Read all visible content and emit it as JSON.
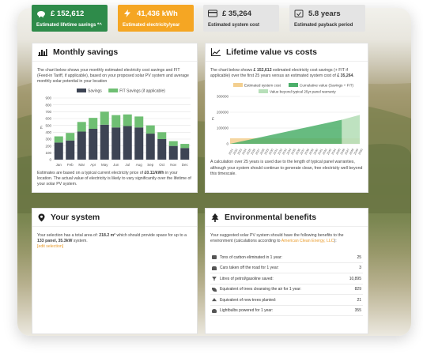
{
  "stats": [
    {
      "value": "£ 152,612",
      "label": "Estimated lifetime savings *^",
      "icon": "piggy-bank-icon"
    },
    {
      "value": "41,436 kWh",
      "label": "Estimated electricity/year",
      "icon": "lightning-icon"
    },
    {
      "value": "£ 35,264",
      "label": "Estimated system cost",
      "icon": "credit-card-icon"
    },
    {
      "value": "5.8 years",
      "label": "Estimated payback period",
      "icon": "calendar-check-icon"
    }
  ],
  "monthly": {
    "title": "Monthly savings",
    "intro": "The chart below shows your monthly estimated electricity cost savings and FIT (Feed-in Tariff, if applicable), based on your proposed solar PV system and average monthly solar potential in your location",
    "footnote_a": "Estimates are based on a typical current electricity price of ",
    "price": "£0.11/kWh",
    "footnote_b": " in your location. The actual value of electricity is likely to vary significantly over the lifetime of your solar PV system."
  },
  "lifetime": {
    "title": "Lifetime value vs costs",
    "intro_a": "The chart below shows ",
    "savings": "£ 152,612",
    "intro_b": " estimated electricity cost savings (+ FIT if applicable) over the first 25 years versus an estimated system cost of ",
    "cost": "£ 35,264",
    "intro_c": ".",
    "footnote": "A calculation over 25 years is used due to the length of typical panel warranties, although your system should continue to generate clean, free electricity well beyond this timescale."
  },
  "system": {
    "title": "Your system",
    "text_a": "Your selection has a total area of: ",
    "area": "218.2 m²",
    "text_b": " which should provide space for up to a ",
    "panels": "133 panel, 35.3kW",
    "text_c": " system.",
    "edit_label": "[edit selection]"
  },
  "benefits": {
    "title": "Environmental benefits",
    "intro_a": "Your suggested solar PV system should have the following benefits to the environment (calculations according to ",
    "source": "American Clean Energy, LLC",
    "intro_b": "):",
    "rows": [
      {
        "label": "Tons of carbon eliminated in 1 year:",
        "value": "25"
      },
      {
        "label": "Cars taken off the road for 1 year:",
        "value": "3"
      },
      {
        "label": "Litres of petrol/gasoline saved:",
        "value": "10,895"
      },
      {
        "label": "Equivalent of trees cleansing the air for 1 year:",
        "value": "829"
      },
      {
        "label": "Equivalent of new trees planted:",
        "value": "21"
      },
      {
        "label": "Lightbulbs powered for 1 year:",
        "value": "355"
      }
    ]
  },
  "chart_data": [
    {
      "type": "bar",
      "categories": [
        "Jan",
        "Feb",
        "Mar",
        "Apr",
        "May",
        "Jun",
        "Jul",
        "Aug",
        "Sep",
        "Oct",
        "Nov",
        "Dec"
      ],
      "series": [
        {
          "name": "Savings",
          "values": [
            250,
            280,
            410,
            450,
            510,
            470,
            490,
            470,
            380,
            300,
            200,
            170
          ],
          "color": "#3d4454"
        },
        {
          "name": "FIT Savings (if applicable)",
          "values": [
            90,
            110,
            140,
            160,
            190,
            180,
            170,
            160,
            120,
            100,
            70,
            60
          ],
          "color": "#6fbf73"
        }
      ],
      "ylim": [
        0,
        900
      ],
      "yticks": [
        0,
        100,
        200,
        300,
        400,
        500,
        600,
        700,
        800,
        900
      ],
      "ylabel": "£",
      "stacked": true,
      "grid": true,
      "legend": "top"
    },
    {
      "type": "area",
      "x": [
        "2021",
        "2022",
        "2023",
        "2024",
        "2025",
        "2026",
        "2027",
        "2028",
        "2029",
        "2030",
        "2031",
        "2032",
        "2033",
        "2034",
        "2035",
        "2036",
        "2037",
        "2038",
        "2039",
        "2040",
        "2041",
        "2042",
        "2043",
        "2044",
        "2045",
        "2046",
        "2047",
        "2048",
        "2049",
        "2050"
      ],
      "series": [
        {
          "name": "Estimated system cost",
          "color": "#f3cf8f"
        },
        {
          "name": "Cumulative value (Savings + FIT)",
          "color": "#4caf6a"
        },
        {
          "name": "Value beyond typical 25yr panel warranty",
          "color": "#b7dfb9"
        }
      ],
      "system_cost": 35264,
      "value_year25": 152612,
      "value_year30": 183000,
      "warranty_years": 25,
      "ylim": [
        0,
        300000
      ],
      "yticks": [
        0,
        100000,
        200000,
        300000
      ],
      "ylabel": "£",
      "grid": true,
      "legend": "top"
    }
  ]
}
